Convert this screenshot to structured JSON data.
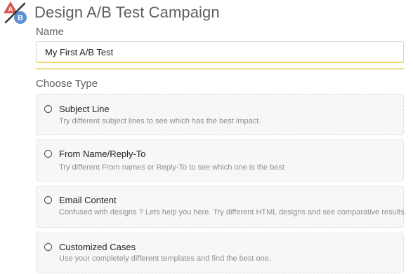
{
  "header": {
    "logo_letter_a": "A",
    "logo_letter_b": "B",
    "title": "Design A/B Test Campaign"
  },
  "name_section": {
    "label": "Name",
    "input_value": "My First A/B Test"
  },
  "type_section": {
    "label": "Choose Type",
    "options": [
      {
        "title": "Subject Line",
        "description": "Try different subject lines to see which has the best impact.",
        "selected": false
      },
      {
        "title": "From Name/Reply-To",
        "description": "Try different From names or Reply-To to see which one is the best",
        "selected": false
      },
      {
        "title": "Email Content",
        "description": "Confused with designs ? Lets help you here. Try different HTML designs and see comparative results.",
        "selected": false
      },
      {
        "title": "Customized Cases",
        "description": "Use your completely different templates and find the best one.",
        "selected": false
      }
    ]
  },
  "colors": {
    "logo_a_red": "#d9534f",
    "logo_b_blue": "#5b8fd6",
    "input_focus_underline": "#f5dc8a",
    "option_background": "#f7f7f7"
  }
}
